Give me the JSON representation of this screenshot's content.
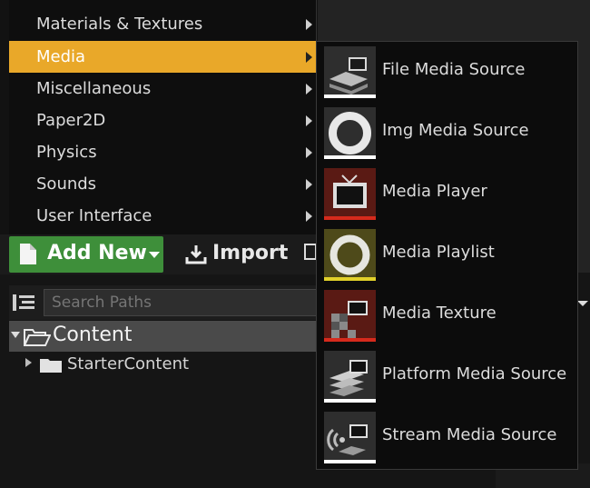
{
  "category_menu": {
    "items": [
      {
        "label": "Materials & Textures",
        "active": false
      },
      {
        "label": "Media",
        "active": true
      },
      {
        "label": "Miscellaneous",
        "active": false
      },
      {
        "label": "Paper2D",
        "active": false
      },
      {
        "label": "Physics",
        "active": false
      },
      {
        "label": "Sounds",
        "active": false
      },
      {
        "label": "User Interface",
        "active": false
      }
    ]
  },
  "toolbar": {
    "add_new_label": "Add New",
    "import_label": "Import"
  },
  "paths": {
    "search_placeholder": "Search Paths",
    "tree": {
      "root_label": "Content",
      "child_label": "StarterContent"
    }
  },
  "media_submenu": {
    "items": [
      {
        "label": "File Media Source",
        "icon": "file-media-source-icon",
        "accent": "#ffffff"
      },
      {
        "label": "Img Media Source",
        "icon": "img-media-source-icon",
        "accent": "#ffffff"
      },
      {
        "label": "Media Player",
        "icon": "media-player-icon",
        "accent": "#d62a1c"
      },
      {
        "label": "Media Playlist",
        "icon": "media-playlist-icon",
        "accent": "#e2d12a"
      },
      {
        "label": "Media Texture",
        "icon": "media-texture-icon",
        "accent": "#d62a1c"
      },
      {
        "label": "Platform Media Source",
        "icon": "platform-media-source-icon",
        "accent": "#ffffff"
      },
      {
        "label": "Stream Media Source",
        "icon": "stream-media-source-icon",
        "accent": "#ffffff"
      }
    ]
  },
  "colors": {
    "menu_highlight": "#e9a829",
    "add_new_green": "#3e8f3a"
  }
}
